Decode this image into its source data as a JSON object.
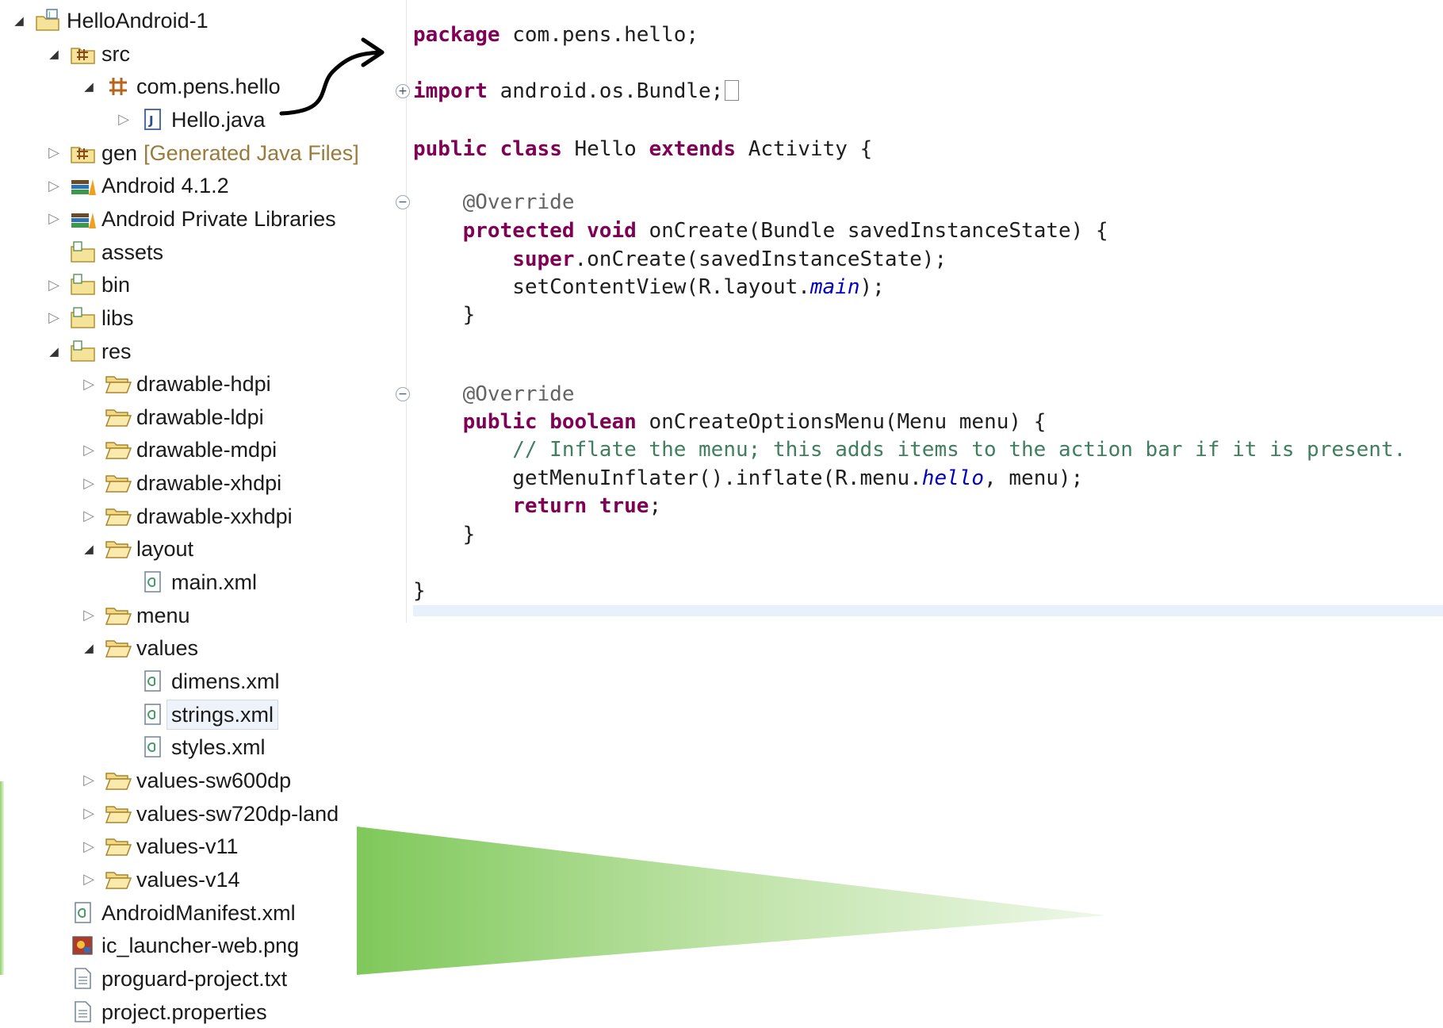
{
  "tree": {
    "items": [
      {
        "id": "project",
        "label": "HelloAndroid-1",
        "depth": 0,
        "toggle": "open",
        "icon": "project-icon"
      },
      {
        "id": "src",
        "label": "src",
        "depth": 1,
        "toggle": "open",
        "icon": "source-folder-icon"
      },
      {
        "id": "package",
        "label": "com.pens.hello",
        "depth": 2,
        "toggle": "open",
        "icon": "package-icon"
      },
      {
        "id": "hello-java",
        "label": "Hello.java",
        "depth": 3,
        "toggle": "closed",
        "icon": "java-file-icon"
      },
      {
        "id": "gen",
        "label": "gen",
        "decoration": "[Generated Java Files]",
        "depth": 1,
        "toggle": "closed",
        "icon": "source-folder-icon"
      },
      {
        "id": "android-412",
        "label": "Android 4.1.2",
        "depth": 1,
        "toggle": "closed",
        "icon": "library-icon"
      },
      {
        "id": "android-private-libs",
        "label": "Android Private Libraries",
        "depth": 1,
        "toggle": "closed",
        "icon": "library-icon"
      },
      {
        "id": "assets",
        "label": "assets",
        "depth": 1,
        "toggle": "none",
        "icon": "folder-icon"
      },
      {
        "id": "bin",
        "label": "bin",
        "depth": 1,
        "toggle": "closed",
        "icon": "folder-icon"
      },
      {
        "id": "libs",
        "label": "libs",
        "depth": 1,
        "toggle": "closed",
        "icon": "folder-icon"
      },
      {
        "id": "res",
        "label": "res",
        "depth": 1,
        "toggle": "open",
        "icon": "folder-icon"
      },
      {
        "id": "drawable-hdpi",
        "label": "drawable-hdpi",
        "depth": 2,
        "toggle": "closed",
        "icon": "open-folder-icon"
      },
      {
        "id": "drawable-ldpi",
        "label": "drawable-ldpi",
        "depth": 2,
        "toggle": "none",
        "icon": "open-folder-icon"
      },
      {
        "id": "drawable-mdpi",
        "label": "drawable-mdpi",
        "depth": 2,
        "toggle": "closed",
        "icon": "open-folder-icon"
      },
      {
        "id": "drawable-xhdpi",
        "label": "drawable-xhdpi",
        "depth": 2,
        "toggle": "closed",
        "icon": "open-folder-icon"
      },
      {
        "id": "drawable-xxhdpi",
        "label": "drawable-xxhdpi",
        "depth": 2,
        "toggle": "closed",
        "icon": "open-folder-icon"
      },
      {
        "id": "layout",
        "label": "layout",
        "depth": 2,
        "toggle": "open",
        "icon": "open-folder-icon"
      },
      {
        "id": "main-xml",
        "label": "main.xml",
        "depth": 3,
        "toggle": "none",
        "icon": "xml-file-icon"
      },
      {
        "id": "menu",
        "label": "menu",
        "depth": 2,
        "toggle": "closed",
        "icon": "open-folder-icon"
      },
      {
        "id": "values",
        "label": "values",
        "depth": 2,
        "toggle": "open",
        "icon": "open-folder-icon"
      },
      {
        "id": "dimens-xml",
        "label": "dimens.xml",
        "depth": 3,
        "toggle": "none",
        "icon": "xml-file-icon"
      },
      {
        "id": "strings-xml",
        "label": "strings.xml",
        "depth": 3,
        "toggle": "none",
        "icon": "xml-file-icon",
        "selected": true
      },
      {
        "id": "styles-xml",
        "label": "styles.xml",
        "depth": 3,
        "toggle": "none",
        "icon": "xml-file-icon"
      },
      {
        "id": "values-sw600dp",
        "label": "values-sw600dp",
        "depth": 2,
        "toggle": "closed",
        "icon": "open-folder-icon"
      },
      {
        "id": "values-sw720dp-land",
        "label": "values-sw720dp-land",
        "depth": 2,
        "toggle": "closed",
        "icon": "open-folder-icon"
      },
      {
        "id": "values-v11",
        "label": "values-v11",
        "depth": 2,
        "toggle": "closed",
        "icon": "open-folder-icon"
      },
      {
        "id": "values-v14",
        "label": "values-v14",
        "depth": 2,
        "toggle": "closed",
        "icon": "open-folder-icon"
      },
      {
        "id": "android-manifest",
        "label": "AndroidManifest.xml",
        "depth": 1,
        "toggle": "none",
        "icon": "xml-file-icon"
      },
      {
        "id": "ic-launcher",
        "label": "ic_launcher-web.png",
        "depth": 1,
        "toggle": "none",
        "icon": "image-file-icon"
      },
      {
        "id": "proguard",
        "label": "proguard-project.txt",
        "depth": 1,
        "toggle": "none",
        "icon": "text-file-icon"
      },
      {
        "id": "project-properties",
        "label": "project.properties",
        "depth": 1,
        "toggle": "none",
        "icon": "text-file-icon"
      }
    ]
  },
  "editor": {
    "lines": [
      {
        "fold": "",
        "tokens": [
          [
            "kw",
            "package"
          ],
          [
            "",
            "com.pens.hello;"
          ]
        ]
      },
      {
        "fold": "plus",
        "tokens": [
          [
            "kw",
            "import"
          ],
          [
            "",
            "android.os.Bundle;"
          ]
        ],
        "folded": true
      },
      {
        "fold": "",
        "tokens": [
          [
            "kw",
            "public"
          ],
          [
            "kw",
            "class"
          ],
          [
            "",
            "Hello"
          ],
          [
            "kw",
            "extends"
          ],
          [
            "",
            "Activity {"
          ]
        ]
      },
      {
        "fold": "minus",
        "tokens": [
          [
            "ann",
            "    @Override"
          ]
        ]
      },
      {
        "fold": "",
        "tokens": [
          [
            "kw",
            "    protected"
          ],
          [
            "kw",
            "void"
          ],
          [
            "",
            "onCreate(Bundle savedInstanceState) {"
          ]
        ]
      },
      {
        "fold": "",
        "tokens": [
          [
            "kw",
            "        super"
          ],
          [
            "",
            ".onCreate(savedInstanceState);"
          ]
        ]
      },
      {
        "fold": "",
        "tokens": [
          [
            "",
            "        setContentView(R.layout."
          ],
          [
            "fld",
            "main"
          ],
          [
            "",
            ");"
          ]
        ]
      },
      {
        "fold": "",
        "tokens": [
          [
            "",
            "    }"
          ]
        ]
      },
      {
        "fold": "minus",
        "tokens": [
          [
            "ann",
            "    @Override"
          ]
        ]
      },
      {
        "fold": "",
        "tokens": [
          [
            "kw",
            "    public"
          ],
          [
            "kw",
            "boolean"
          ],
          [
            "",
            "onCreateOptionsMenu(Menu menu) {"
          ]
        ]
      },
      {
        "fold": "",
        "tokens": [
          [
            "cm",
            "        // Inflate the menu; this adds items to the action bar if it is present."
          ]
        ]
      },
      {
        "fold": "",
        "tokens": [
          [
            "",
            "        getMenuInflater().inflate(R.menu."
          ],
          [
            "fld",
            "hello"
          ],
          [
            "",
            ", menu);"
          ]
        ]
      },
      {
        "fold": "",
        "tokens": [
          [
            "kw",
            "        return"
          ],
          [
            "kw",
            "true"
          ],
          [
            "",
            ";"
          ]
        ]
      },
      {
        "fold": "",
        "tokens": [
          [
            "",
            "    }"
          ]
        ]
      },
      {
        "fold": "",
        "tokens": [
          [
            "",
            "}"
          ]
        ]
      }
    ]
  },
  "colors": {
    "keyword": "#7f0055",
    "annotation": "#646464",
    "comment": "#3f7f5f",
    "field": "#0000c0",
    "wedge": "#7fc85a",
    "selection": "#eef3fa"
  }
}
